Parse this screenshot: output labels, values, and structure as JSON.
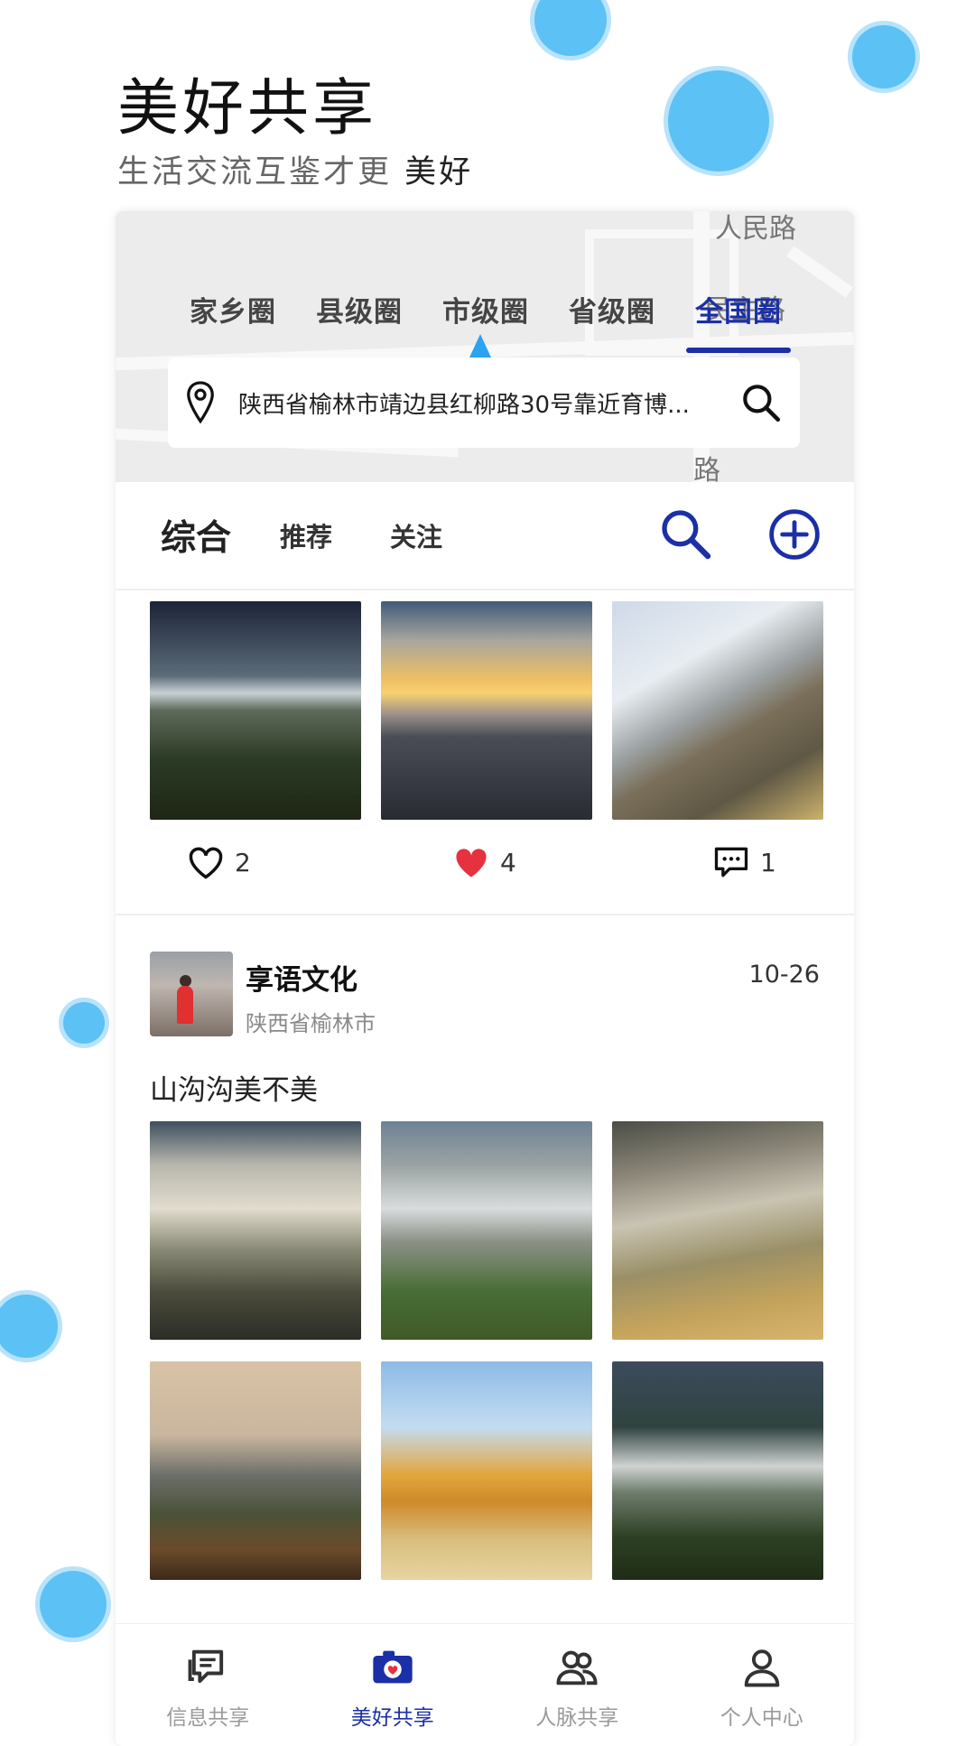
{
  "hero": {
    "title": "美好共享",
    "subtitle_plain": "生活交流互鉴才更 ",
    "subtitle_strong": "美好"
  },
  "map": {
    "road_labels": [
      "人民路",
      "民主路",
      "路"
    ]
  },
  "circle_tabs": [
    {
      "label": "家乡圈",
      "active": false
    },
    {
      "label": "县级圈",
      "active": false
    },
    {
      "label": "市级圈",
      "active": false
    },
    {
      "label": "省级圈",
      "active": false
    },
    {
      "label": "全国圈",
      "active": true
    }
  ],
  "location": {
    "address": "陕西省榆林市靖边县红柳路30号靠近育博...",
    "pin_icon": "location-pin-icon",
    "search_icon": "search-icon"
  },
  "feed_tabs": {
    "main": "综合",
    "recommend": "推荐",
    "follow": "关注",
    "search_icon": "search-icon",
    "add_icon": "plus-circle-icon"
  },
  "post1": {
    "like_count": "2",
    "liked_count": "4",
    "comment_count": "1"
  },
  "post2": {
    "user": "享语文化",
    "location": "陕西省榆林市",
    "date": "10-26",
    "text": "山沟沟美不美"
  },
  "bottom_nav": [
    {
      "label": "信息共享",
      "icon": "message-icon",
      "active": false
    },
    {
      "label": "美好共享",
      "icon": "camera-heart-icon",
      "active": true
    },
    {
      "label": "人脉共享",
      "icon": "people-icon",
      "active": false
    },
    {
      "label": "个人中心",
      "icon": "person-icon",
      "active": false
    }
  ],
  "colors": {
    "accent": "#1b2fa6",
    "bubble": "#5cc1f4",
    "liked": "#e5323e"
  }
}
